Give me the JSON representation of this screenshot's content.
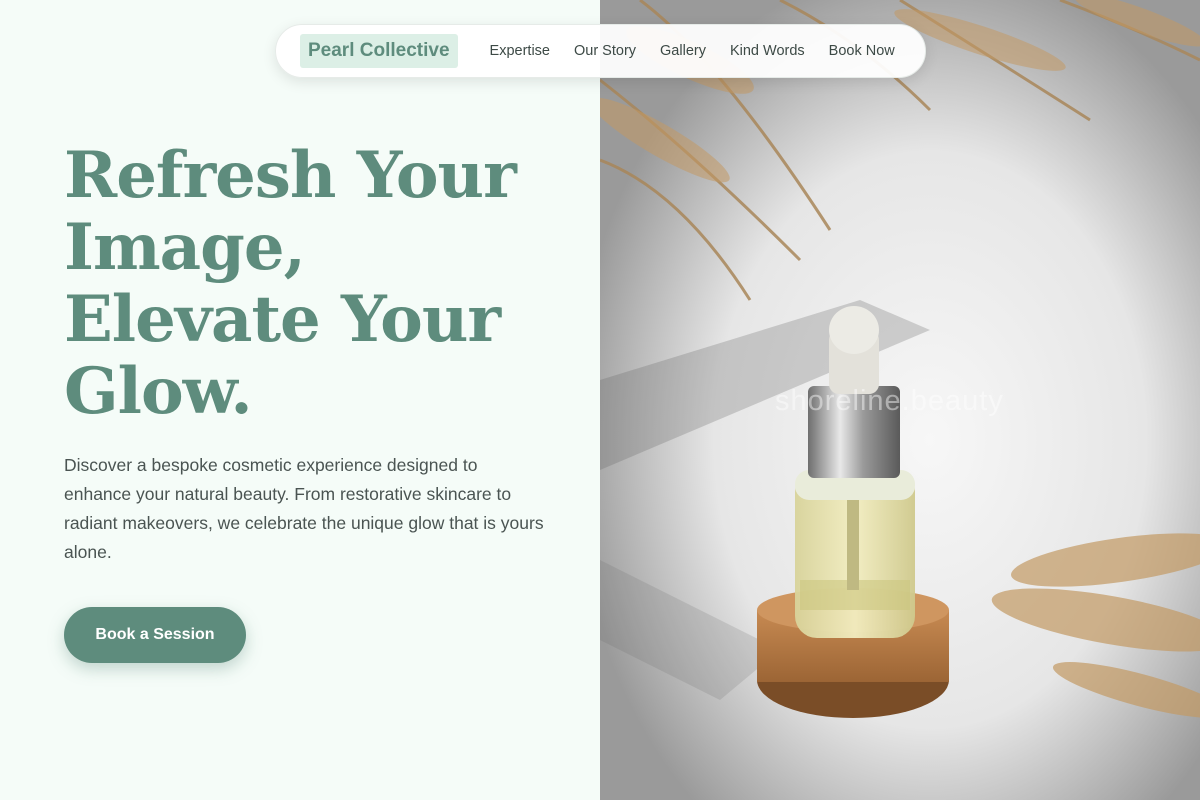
{
  "brand": "Pearl Collective",
  "nav": {
    "links": [
      "Expertise",
      "Our Story",
      "Gallery",
      "Kind Words",
      "Book Now"
    ]
  },
  "hero": {
    "title_lines": [
      "Refresh Your",
      "Image,",
      "Elevate Your",
      "Glow."
    ],
    "description": "Discover a bespoke cosmetic experience designed to enhance your natural beauty. From restorative skincare to radiant makeovers, we celebrate the unique glow that is yours alone.",
    "cta": "Book a Session"
  },
  "photo": {
    "watermark": "shoreline.beauty",
    "subject": "serum dropper bottle on cork stand with dried grass"
  },
  "colors": {
    "accent": "#5e8c7d",
    "brand_bg": "#dcefe6",
    "page_bg": "#f5fcf8",
    "text": "#4a5452"
  }
}
